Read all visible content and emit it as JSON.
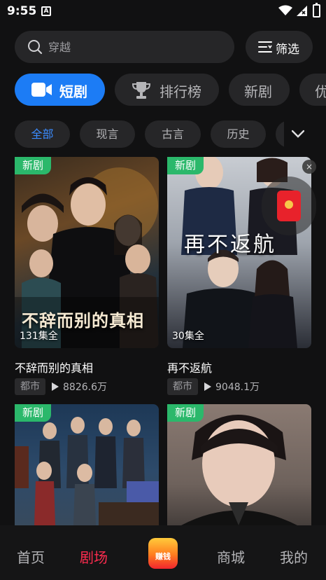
{
  "status_bar": {
    "time": "9:55",
    "badge": "A"
  },
  "search": {
    "placeholder": "穿越",
    "filter_label": "筛选"
  },
  "categories": [
    {
      "label": "短剧",
      "active": true
    },
    {
      "label": "排行榜",
      "active": false
    },
    {
      "label": "新剧",
      "active": false
    },
    {
      "label": "优",
      "active": false
    }
  ],
  "genre_chips": [
    {
      "label": "全部",
      "active": true
    },
    {
      "label": "现言",
      "active": false
    },
    {
      "label": "古言",
      "active": false
    },
    {
      "label": "历史",
      "active": false
    }
  ],
  "dramas": [
    {
      "tag": "新剧",
      "episodes": "131集全",
      "poster_text": "不辞而别的真相",
      "title": "不辞而别的真相",
      "genre": "都市",
      "plays": "8826.6万"
    },
    {
      "tag": "新剧",
      "episodes": "30集全",
      "poster_text": "再不返航",
      "title": "再不返航",
      "genre": "都市",
      "plays": "9048.1万"
    },
    {
      "tag": "新剧"
    },
    {
      "tag": "新剧"
    }
  ],
  "floating_widget": {
    "close": "×"
  },
  "bottom_nav": {
    "home": "首页",
    "theater": "剧场",
    "earn": "赚钱",
    "mall": "商城",
    "mine": "我的"
  },
  "colors": {
    "accent_blue": "#1c7cf5",
    "active_nav": "#ff2c4f",
    "new_tag": "#2bb86b"
  }
}
